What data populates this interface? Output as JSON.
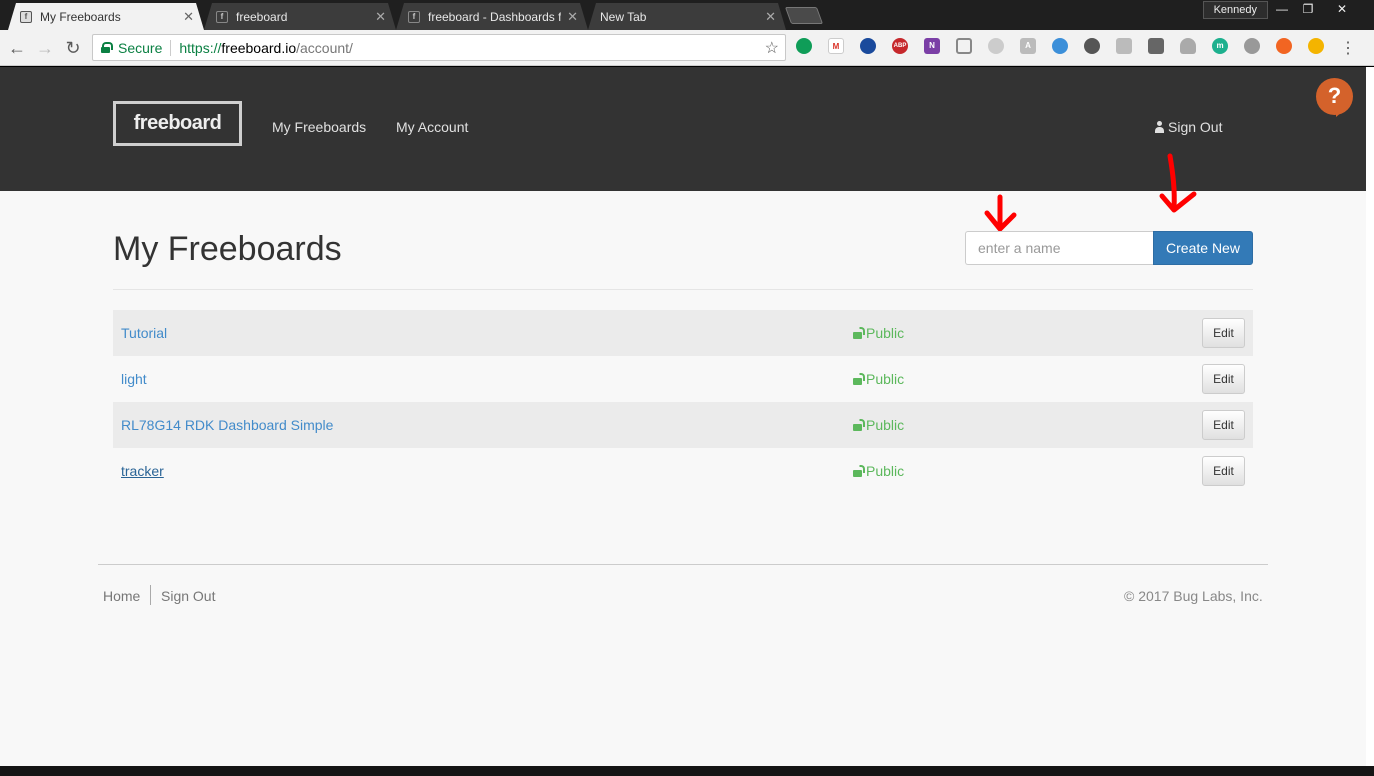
{
  "browser": {
    "tabs": [
      {
        "label": "My Freeboards",
        "active": true
      },
      {
        "label": "freeboard",
        "active": false
      },
      {
        "label": "freeboard - Dashboards f",
        "active": false
      },
      {
        "label": "New Tab",
        "active": false
      }
    ],
    "profile_name": "Kennedy",
    "security_label": "Secure",
    "url_scheme": "https://",
    "url_host": "freeboard.io",
    "url_path": "/account/"
  },
  "header": {
    "logo_text": "freeboard",
    "nav": [
      "My Freeboards",
      "My Account"
    ],
    "sign_out": "Sign Out",
    "help_glyph": "?"
  },
  "main": {
    "title": "My Freeboards",
    "name_placeholder": "enter a name",
    "create_label": "Create New",
    "boards": [
      {
        "name": "Tutorial",
        "visibility": "Public",
        "action": "Edit"
      },
      {
        "name": "light",
        "visibility": "Public",
        "action": "Edit"
      },
      {
        "name": "RL78G14 RDK Dashboard Simple",
        "visibility": "Public",
        "action": "Edit"
      },
      {
        "name": "tracker",
        "visibility": "Public",
        "action": "Edit"
      }
    ]
  },
  "footer": {
    "home": "Home",
    "sign_out": "Sign Out",
    "copyright": "© 2017 Bug Labs, Inc."
  },
  "colors": {
    "header_bg": "#333333",
    "primary_button": "#337ab7",
    "link": "#428bca",
    "public_green": "#5cb85c",
    "annotation_red": "#ff0000"
  }
}
